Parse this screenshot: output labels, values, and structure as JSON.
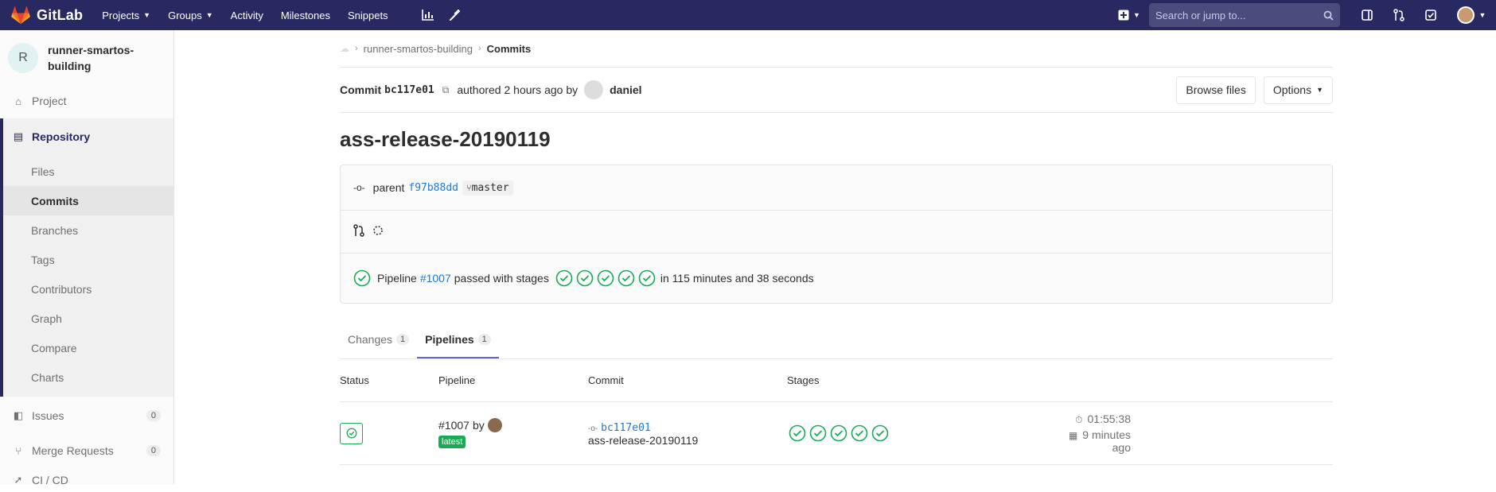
{
  "navbar": {
    "brand": "GitLab",
    "links": [
      {
        "label": "Projects",
        "dropdown": true
      },
      {
        "label": "Groups",
        "dropdown": true
      },
      {
        "label": "Activity",
        "dropdown": false
      },
      {
        "label": "Milestones",
        "dropdown": false
      },
      {
        "label": "Snippets",
        "dropdown": false
      }
    ],
    "search_placeholder": "Search or jump to..."
  },
  "sidebar": {
    "avatar_letter": "R",
    "project_name": "runner-smartos-building",
    "items": [
      {
        "label": "Project",
        "icon": "home-icon"
      },
      {
        "label": "Repository",
        "icon": "doc-icon"
      },
      {
        "label": "Issues",
        "icon": "issues-icon",
        "count": "0"
      },
      {
        "label": "Merge Requests",
        "icon": "merge-request-icon",
        "count": "0"
      },
      {
        "label": "CI / CD",
        "icon": "rocket-icon"
      }
    ],
    "repo_subitems": [
      "Files",
      "Commits",
      "Branches",
      "Tags",
      "Contributors",
      "Graph",
      "Compare",
      "Charts"
    ]
  },
  "breadcrumb": {
    "project": "runner-smartos-building",
    "current": "Commits"
  },
  "commit": {
    "label": "Commit",
    "sha": "bc117e01",
    "authored_text": "authored 2 hours ago by",
    "author": "daniel",
    "title": "ass-release-20190119",
    "parent_label": "parent",
    "parent_sha": "f97b88dd",
    "branch": "master",
    "pipeline_text_before": "Pipeline",
    "pipeline_id": "#1007",
    "pipeline_text_mid": "passed with stages",
    "pipeline_text_after": "in 115 minutes and 38 seconds",
    "stage_count": 5
  },
  "buttons": {
    "browse_files": "Browse files",
    "options": "Options"
  },
  "tabs": [
    {
      "label": "Changes",
      "count": "1"
    },
    {
      "label": "Pipelines",
      "count": "1"
    }
  ],
  "table": {
    "headers": [
      "Status",
      "Pipeline",
      "Commit",
      "Stages"
    ],
    "row": {
      "pipeline_id": "#1007",
      "by": "by",
      "latest": "latest",
      "commit_sha": "bc117e01",
      "commit_title": "ass-release-20190119",
      "duration": "01:55:38",
      "finished": "9 minutes ago"
    }
  },
  "colors": {
    "navbar": "#292961",
    "success": "#1aaa55",
    "link": "#1f78d1"
  }
}
